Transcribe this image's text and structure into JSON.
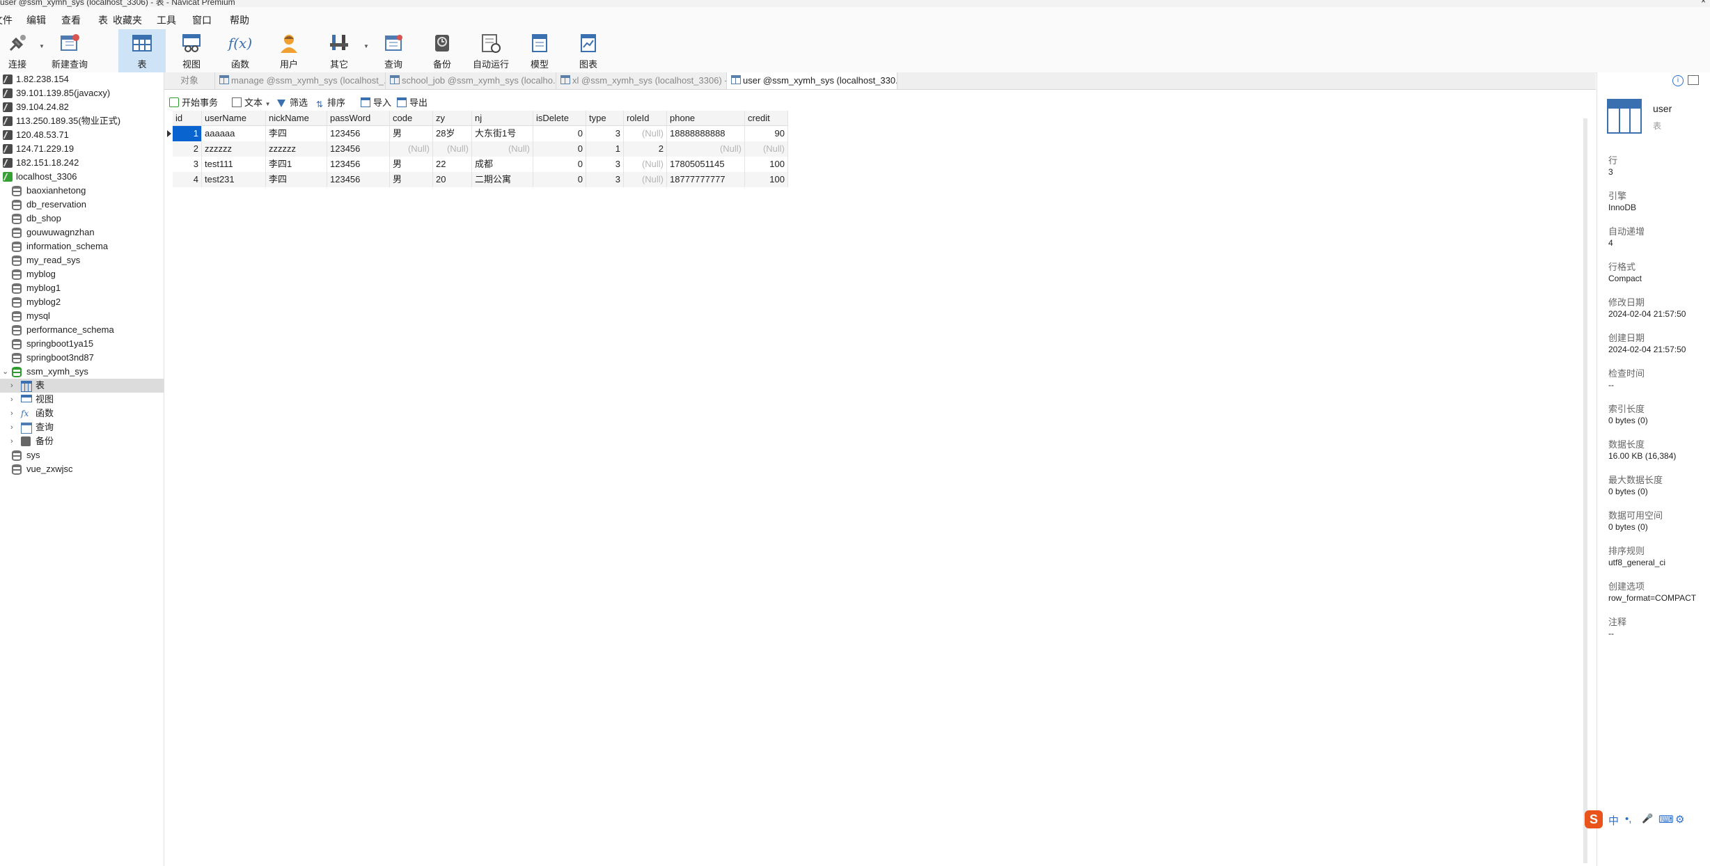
{
  "window": {
    "title": "user @ssm_xymh_sys (localhost_3306) - 表 - Navicat Premium",
    "close_glyph": "×"
  },
  "menu": [
    "文件",
    "编辑",
    "查看",
    "表",
    "收藏夹",
    "工具",
    "窗口",
    "帮助"
  ],
  "toolbar": {
    "items": [
      {
        "label": "连接",
        "icon": "connect-icon"
      },
      {
        "label": "新建查询",
        "icon": "new-query-icon"
      },
      {
        "label": "表",
        "icon": "table-icon",
        "active": true
      },
      {
        "label": "视图",
        "icon": "view-icon"
      },
      {
        "label": "函数",
        "icon": "function-icon"
      },
      {
        "label": "用户",
        "icon": "user-icon"
      },
      {
        "label": "其它",
        "icon": "tools-icon"
      },
      {
        "label": "查询",
        "icon": "query-icon"
      },
      {
        "label": "备份",
        "icon": "backup-icon"
      },
      {
        "label": "自动运行",
        "icon": "autorun-icon"
      },
      {
        "label": "模型",
        "icon": "model-icon"
      },
      {
        "label": "图表",
        "icon": "chart-icon"
      }
    ],
    "function_glyph": "f(x)"
  },
  "tree": {
    "connections": [
      "1.82.238.154",
      "39.101.139.85(javacxy)",
      "39.104.24.82",
      "113.250.189.35(物业正式)",
      "120.48.53.71",
      "124.71.229.19",
      "182.151.18.242"
    ],
    "active_connection": "localhost_3306",
    "databases_before": [
      "baoxianhetong",
      "db_reservation",
      "db_shop",
      "gouwuwagnzhan",
      "information_schema",
      "my_read_sys",
      "myblog",
      "myblog1",
      "myblog2",
      "mysql",
      "performance_schema",
      "springboot1ya15",
      "springboot3nd87"
    ],
    "open_database": "ssm_xymh_sys",
    "children": [
      "表",
      "视图",
      "函数",
      "查询",
      "备份"
    ],
    "databases_after": [
      "sys",
      "vue_zxwjsc"
    ]
  },
  "tabs": [
    {
      "label": "对象",
      "active": false
    },
    {
      "label": "manage @ssm_xymh_sys (localhost_...",
      "active": false
    },
    {
      "label": "school_job @ssm_xymh_sys (localho...",
      "active": false
    },
    {
      "label": "xl @ssm_xymh_sys (localhost_3306) -...",
      "active": false
    },
    {
      "label": "user @ssm_xymh_sys (localhost_330...",
      "active": true
    }
  ],
  "grid_toolbar": {
    "begin_tx": "开始事务",
    "text": "文本",
    "filter": "筛选",
    "sort": "排序",
    "import": "导入",
    "export": "导出"
  },
  "grid": {
    "columns": [
      "id",
      "userName",
      "nickName",
      "passWord",
      "code",
      "zy",
      "nj",
      "isDelete",
      "type",
      "roleId",
      "phone",
      "credit"
    ],
    "rows": [
      [
        "1",
        "aaaaaa",
        "李四",
        "123456",
        "男",
        "28岁",
        "大东街1号",
        "0",
        "3",
        "(Null)",
        "18888888888",
        "90"
      ],
      [
        "2",
        "zzzzzz",
        "zzzzzz",
        "123456",
        "(Null)",
        "(Null)",
        "(Null)",
        "0",
        "1",
        "2",
        "(Null)",
        "(Null)"
      ],
      [
        "3",
        "test111",
        "李四1",
        "123456",
        "男",
        "22",
        "成都",
        "0",
        "3",
        "(Null)",
        "17805051145",
        "100"
      ],
      [
        "4",
        "test231",
        "李四",
        "123456",
        "男",
        "20",
        "二期公寓",
        "0",
        "3",
        "(Null)",
        "18777777777",
        "100"
      ]
    ]
  },
  "info_panel": {
    "name": "user",
    "kind": "表",
    "fields": [
      {
        "label": "行",
        "value": "3"
      },
      {
        "label": "引擎",
        "value": "InnoDB"
      },
      {
        "label": "自动递增",
        "value": "4"
      },
      {
        "label": "行格式",
        "value": "Compact"
      },
      {
        "label": "修改日期",
        "value": "2024-02-04 21:57:50"
      },
      {
        "label": "创建日期",
        "value": "2024-02-04 21:57:50"
      },
      {
        "label": "检查时间",
        "value": "--"
      },
      {
        "label": "索引长度",
        "value": "0 bytes (0)"
      },
      {
        "label": "数据长度",
        "value": "16.00 KB (16,384)"
      },
      {
        "label": "最大数据长度",
        "value": "0 bytes (0)"
      },
      {
        "label": "数据可用空间",
        "value": "0 bytes (0)"
      },
      {
        "label": "排序规则",
        "value": "utf8_general_ci"
      },
      {
        "label": "创建选项",
        "value": "row_format=COMPACT"
      },
      {
        "label": "注释",
        "value": "--"
      }
    ]
  },
  "ime": {
    "logo": "S",
    "glyphs": [
      "中",
      "•,",
      "🎤",
      "⌨",
      "⚙"
    ]
  }
}
